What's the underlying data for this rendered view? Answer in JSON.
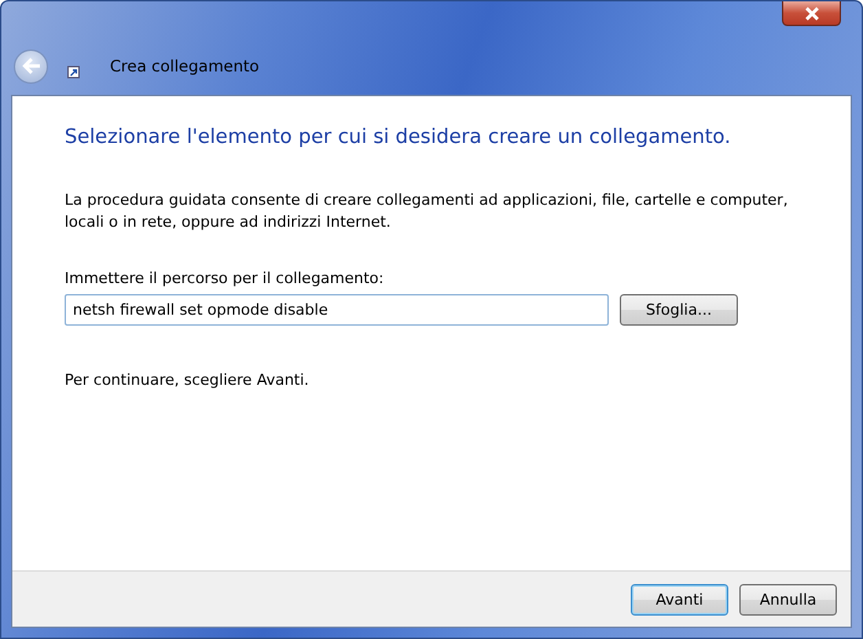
{
  "window": {
    "title": "Crea collegamento"
  },
  "heading": "Selezionare l'elemento per cui si desidera creare un collegamento.",
  "description": "La procedura guidata consente di creare collegamenti ad applicazioni, file, cartelle e computer, locali o in rete, oppure ad indirizzi Internet.",
  "path": {
    "label": "Immettere il percorso per il collegamento:",
    "value": "netsh firewall set opmode disable",
    "browse_button": "Sfoglia..."
  },
  "hint": "Per continuare, scegliere Avanti.",
  "buttons": [
    {
      "label": "Avanti",
      "default": true
    },
    {
      "label": "Annulla",
      "default": false
    }
  ]
}
